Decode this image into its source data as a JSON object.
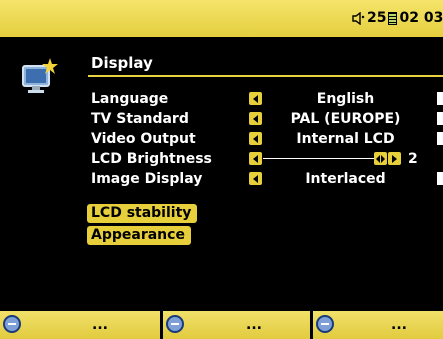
{
  "status_bar": {
    "volume_icon": "speaker-icon",
    "volume": "25",
    "battery_icon": "battery-icon",
    "time": "02 03"
  },
  "screen": {
    "icon": "display-monitor-icon",
    "title": "Display"
  },
  "settings": [
    {
      "label": "Language",
      "value": "English"
    },
    {
      "label": "TV Standard",
      "value": "PAL (EUROPE)"
    },
    {
      "label": "Video Output",
      "value": "Internal LCD"
    },
    {
      "label": "LCD Brightness",
      "value": "2"
    },
    {
      "label": "Image Display",
      "value": "Interlaced"
    }
  ],
  "buttons": {
    "lcd_stability": "LCD stability",
    "appearance": "Appearance"
  },
  "softkeys": [
    {
      "icon": "minus-icon",
      "label": "..."
    },
    {
      "icon": "minus-icon",
      "label": "..."
    },
    {
      "icon": "minus-icon",
      "label": "..."
    }
  ],
  "colors": {
    "accent": "#e6cf3a",
    "background": "#000000"
  }
}
